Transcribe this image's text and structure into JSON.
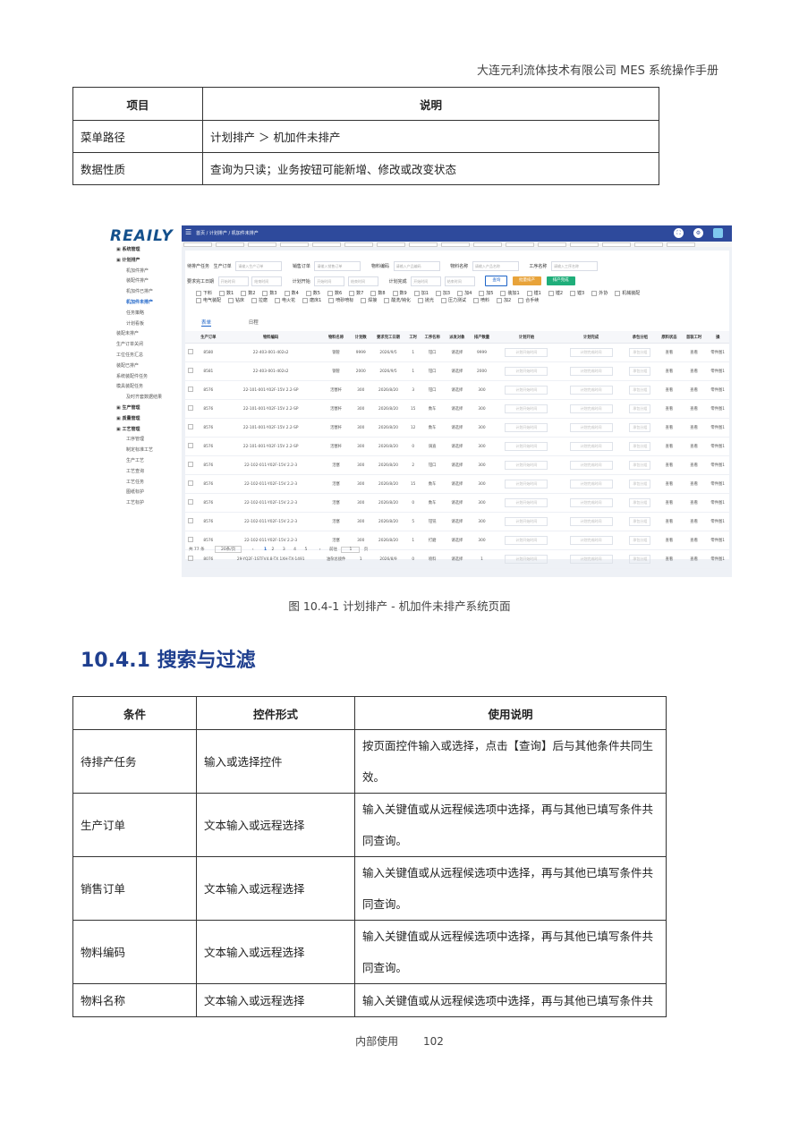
{
  "header": {
    "company": "大连元利流体技术有限公司 MES 系统操作手册"
  },
  "table1": {
    "head": [
      "项目",
      "说明"
    ],
    "rows": [
      [
        "菜单路径",
        "计划排产 ＞ 机加件未排产"
      ],
      [
        "数据性质",
        "查询为只读；业务按钮可能新增、修改或改变状态"
      ]
    ]
  },
  "screenshot": {
    "logo": "REAILY",
    "breadcrumb": "首页 / 计划排产 / 机加件未排产",
    "sidebar": [
      {
        "label": "系统管理",
        "type": "group"
      },
      {
        "label": "计划排产",
        "type": "group"
      },
      {
        "label": "机加件排产",
        "type": "item"
      },
      {
        "label": "装配件排产",
        "type": "item"
      },
      {
        "label": "机加件已排产",
        "type": "item"
      },
      {
        "label": "机加件未排产",
        "type": "active"
      },
      {
        "label": "任务策略",
        "type": "item"
      },
      {
        "label": "计划看板",
        "type": "item"
      },
      {
        "label": "装配未排产",
        "type": "sub"
      },
      {
        "label": "生产订单关闭",
        "type": "sub"
      },
      {
        "label": "工位任务汇总",
        "type": "sub"
      },
      {
        "label": "装配已排产",
        "type": "sub"
      },
      {
        "label": "系统装配件任务",
        "type": "sub"
      },
      {
        "label": "模具装配任务",
        "type": "sub"
      },
      {
        "label": "及时齐套数据结果",
        "type": "item"
      },
      {
        "label": "生产管理",
        "type": "group"
      },
      {
        "label": "质量管理",
        "type": "group"
      },
      {
        "label": "工艺管理",
        "type": "group"
      },
      {
        "label": "工序管理",
        "type": "item"
      },
      {
        "label": "制定标准工艺",
        "type": "item"
      },
      {
        "label": "生产工艺",
        "type": "item"
      },
      {
        "label": "工艺查询",
        "type": "item"
      },
      {
        "label": "工艺任务",
        "type": "item"
      },
      {
        "label": "图纸标护",
        "type": "item"
      },
      {
        "label": "工艺标护",
        "type": "item"
      }
    ],
    "filters": {
      "task_label": "待排产任务",
      "order_label": "生产订单",
      "order_ph": "请输入生产订单",
      "sales_label": "销售订单",
      "sales_ph": "请输入销售订单",
      "mat_code_label": "物料编码",
      "mat_code_ph": "请输入产品编码",
      "mat_name_label": "物料名称",
      "mat_name_ph": "请输入产品名称",
      "process_label": "工序名称",
      "process_ph": "请输入工序名称",
      "date_label": "要求完工日期",
      "date_start": "开始时间",
      "date_end": "结束时间",
      "plan_start_label": "计划开始",
      "plan_end_label": "计划完成",
      "btn_query": "查询",
      "btn_batch": "批量排产",
      "btn_done": "排产完成"
    },
    "checks1": [
      "下料",
      "数1",
      "数2",
      "数3",
      "数4",
      "数5",
      "数6",
      "数7",
      "数8",
      "数9",
      "加1",
      "加3",
      "加4",
      "加5",
      "装加1",
      "镗1",
      "镗2",
      "镗3",
      "外协",
      "机械装配"
    ],
    "checks2": [
      "电气装配",
      "钻床",
      "拉磨",
      "电火花",
      "磨床1",
      "喷砂喷标",
      "焊接",
      "酸洗/钝化",
      "抛光",
      "压力测试",
      "喷料",
      "加2",
      "合手续"
    ],
    "tabs": [
      "表单",
      "日程"
    ],
    "columns": [
      "生产订单",
      "物料编码",
      "物料名称",
      "计划数",
      "要求完工日期",
      "工时",
      "工序名称",
      "派发对象",
      "排产数量",
      "计划开始",
      "计划完成",
      "承包分组",
      "原料状态",
      "首装工时",
      "操"
    ],
    "rows": [
      [
        "8580",
        "22-403-001-402s2",
        "钢管",
        "9999",
        "2026/9/5",
        "1",
        "钳口",
        "请选择",
        "9999",
        "",
        "",
        "",
        "查看",
        "查看",
        "零件图1"
      ],
      [
        "8581",
        "22-403-001-402s2",
        "钢管",
        "2000",
        "2026/9/5",
        "1",
        "钳口",
        "请选择",
        "2000",
        "",
        "",
        "",
        "查看",
        "查看",
        "零件图1"
      ],
      [
        "8576",
        "22-101-001-Y02F-15V 2.2-SP",
        "活塞杆",
        "300",
        "2026/8/20",
        "3",
        "钳口",
        "请选择",
        "300",
        "",
        "",
        "",
        "查看",
        "查看",
        "零件图1"
      ],
      [
        "8576",
        "22-101-001-Y02F-15V 2.2-SP",
        "活塞杆",
        "300",
        "2026/8/20",
        "15",
        "数车",
        "请选择",
        "300",
        "",
        "",
        "",
        "查看",
        "查看",
        "零件图1"
      ],
      [
        "8576",
        "22-101-001-Y02F-15V 2.2-SP",
        "活塞杆",
        "300",
        "2026/8/20",
        "12",
        "数车",
        "请选择",
        "300",
        "",
        "",
        "",
        "查看",
        "查看",
        "零件图1"
      ],
      [
        "8576",
        "22-101-001-Y02F-15V 2.2-SP",
        "活塞杆",
        "300",
        "2026/8/20",
        "0",
        "调直",
        "请选择",
        "300",
        "",
        "",
        "",
        "查看",
        "查看",
        "零件图1"
      ],
      [
        "8576",
        "22-102-011-Y02F-15V 2.2-3",
        "活塞",
        "300",
        "2026/8/20",
        "2",
        "钳口",
        "请选择",
        "300",
        "",
        "",
        "",
        "查看",
        "查看",
        "零件图1"
      ],
      [
        "8576",
        "22-102-011-Y02F-15V 2.2-3",
        "活塞",
        "300",
        "2026/8/20",
        "15",
        "数车",
        "请选择",
        "300",
        "",
        "",
        "",
        "查看",
        "查看",
        "零件图1"
      ],
      [
        "8576",
        "22-102-011-Y02F-15V 2.2-3",
        "活塞",
        "300",
        "2026/8/20",
        "0",
        "数车",
        "请选择",
        "300",
        "",
        "",
        "",
        "查看",
        "查看",
        "零件图1"
      ],
      [
        "8576",
        "22-102-011-Y02F-15V 2.2-3",
        "活塞",
        "300",
        "2026/8/20",
        "5",
        "钳铣",
        "请选择",
        "300",
        "",
        "",
        "",
        "查看",
        "查看",
        "零件图1"
      ],
      [
        "8576",
        "22-102-011-Y02F-15V 2.2-3",
        "活塞",
        "300",
        "2026/8/20",
        "1",
        "打磨",
        "请选择",
        "300",
        "",
        "",
        "",
        "查看",
        "查看",
        "零件图1"
      ],
      [
        "8076",
        "29-YQ2F-1STFV4.8-TX 1XH-TX-1491",
        "油杂总接件",
        "1",
        "2026/8/9",
        "0",
        "喷料",
        "请选择",
        "1",
        "",
        "",
        "",
        "查看",
        "查看",
        "零件图1"
      ]
    ],
    "cell_ph_start": "计划开始时间",
    "cell_ph_end": "计划完成时间",
    "cell_ph_group": "承包分组",
    "pager": {
      "total": "共 77 条",
      "size": "20条/页",
      "pages": [
        "1",
        "2",
        "3",
        "4",
        "5"
      ],
      "goto": "前往",
      "page": "1",
      "unit": "页"
    }
  },
  "caption": "图 10.4-1   计划排产 - 机加件未排产系统页面",
  "section_title": "10.4.1  搜索与过滤",
  "table2": {
    "head": [
      "条件",
      "控件形式",
      "使用说明"
    ],
    "rows": [
      [
        "待排产任务",
        "输入或选择控件",
        "按页面控件输入或选择，点击【查询】后与其他条件共同生效。"
      ],
      [
        "生产订单",
        "文本输入或远程选择",
        "输入关键值或从远程候选项中选择，再与其他已填写条件共同查询。"
      ],
      [
        "销售订单",
        "文本输入或远程选择",
        "输入关键值或从远程候选项中选择，再与其他已填写条件共同查询。"
      ],
      [
        "物料编码",
        "文本输入或远程选择",
        "输入关键值或从远程候选项中选择，再与其他已填写条件共同查询。"
      ],
      [
        "物料名称",
        "文本输入或远程选择",
        "输入关键值或从远程候选项中选择，再与其他已填写条件共"
      ]
    ]
  },
  "footer": {
    "label": "内部使用",
    "page": "102"
  },
  "colors": {
    "nav": "#2e4a9c",
    "accent": "#1e64c8",
    "title": "#1f3f8f",
    "btn_query": "#ffffff",
    "btn_batch": "#e8a33a",
    "btn_done": "#1fae7a"
  }
}
